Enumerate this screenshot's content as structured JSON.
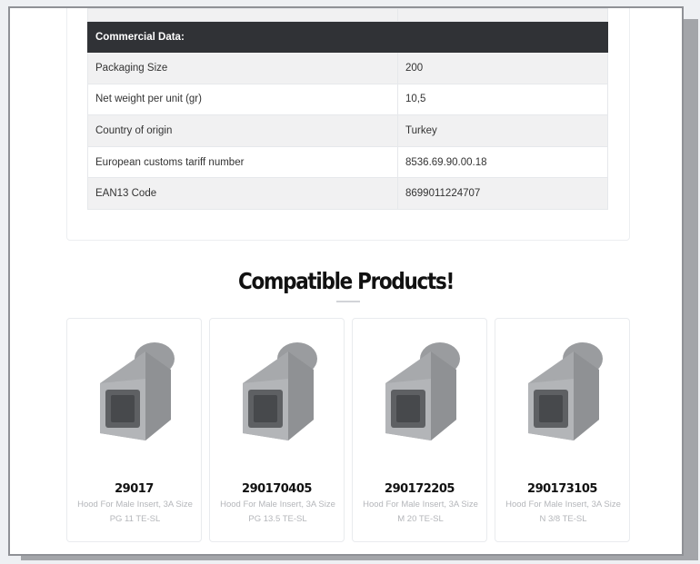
{
  "commercial_table": {
    "heading": "Commercial Data:",
    "rows": [
      {
        "label": "Packaging Size",
        "value": "200"
      },
      {
        "label": "Net weight per unit (gr)",
        "value": "10,5"
      },
      {
        "label": "Country of origin",
        "value": "Turkey"
      },
      {
        "label": "European customs tariff number",
        "value": "8536.69.90.00.18"
      },
      {
        "label": "EAN13 Code",
        "value": "8699011224707"
      }
    ]
  },
  "compatible": {
    "title": "Compatible Products!",
    "products": [
      {
        "code": "29017",
        "description": "Hood For Male Insert, 3A Size PG 11 TE-SL",
        "image_icon": "connector-hood-image"
      },
      {
        "code": "290170405",
        "description": "Hood For Male Insert, 3A Size PG 13.5 TE-SL",
        "image_icon": "connector-hood-image"
      },
      {
        "code": "290172205",
        "description": "Hood For Male Insert, 3A Size M 20 TE-SL",
        "image_icon": "connector-hood-image"
      },
      {
        "code": "290173105",
        "description": "Hood For Male Insert, 3A Size N 3/8 TE-SL",
        "image_icon": "connector-hood-image"
      }
    ]
  },
  "colors": {
    "table_header_bg": "#303236",
    "row_alt_bg": "#f1f1f2",
    "product_desc": "#b4b6ba"
  }
}
